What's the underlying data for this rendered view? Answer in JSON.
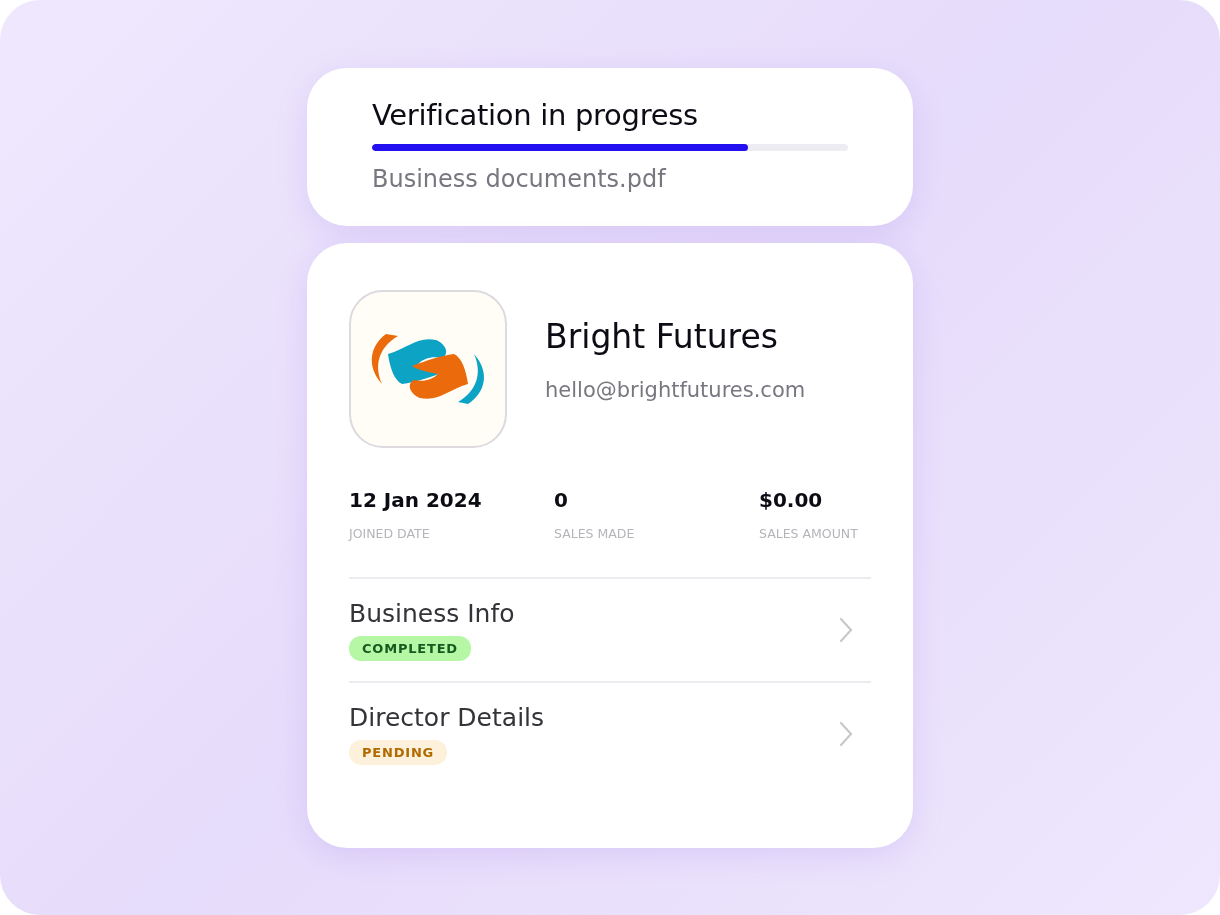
{
  "verification": {
    "title": "Verification in progress",
    "level": 0.79,
    "file_name": "Business documents.pdf"
  },
  "profile": {
    "name": "Bright Futures",
    "email": "hello@brightfutures.com"
  },
  "stats": [
    {
      "value": "12 Jan 2024",
      "label": "JOINED DATE"
    },
    {
      "value": "0",
      "label": "SALES MADE"
    },
    {
      "value": "$0.00",
      "label": "SALES AMOUNT"
    }
  ],
  "sections": [
    {
      "title": "Business Info",
      "status": "COMPLETED",
      "kind": "completed"
    },
    {
      "title": "Director Details",
      "status": "PENDING",
      "kind": "pending"
    }
  ]
}
